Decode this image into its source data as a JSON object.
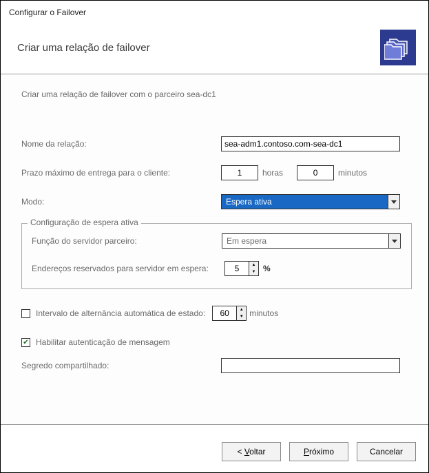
{
  "window": {
    "title": "Configurar o Failover"
  },
  "header": {
    "title": "Criar uma relação de failover"
  },
  "intro": "Criar uma relação de failover com o parceiro sea-dc1",
  "fields": {
    "relation_name_label": "Nome da relação:",
    "relation_name_value": "sea-adm1.contoso.com-sea-dc1",
    "max_client_label": "Prazo máximo de entrega para o cliente:",
    "max_client_hours": "1",
    "hours_unit": "horas",
    "max_client_minutes": "0",
    "minutes_unit": "minutos",
    "mode_label": "Modo:",
    "mode_value": "Espera ativa"
  },
  "group": {
    "legend": "Configuração de espera ativa",
    "partner_role_label": "Função do servidor parceiro:",
    "partner_role_value": "Em espera",
    "reserved_label": "Endereços reservados para servidor em espera:",
    "reserved_value": "5",
    "percent_unit": "%"
  },
  "options": {
    "auto_switch_label": "Intervalo de alternância automática de estado:",
    "auto_switch_checked": false,
    "auto_switch_value": "60",
    "auto_switch_unit": "minutos",
    "msg_auth_label": "Habilitar autenticação de mensagem",
    "msg_auth_checked": true,
    "shared_secret_label": "Segredo compartilhado:",
    "shared_secret_value": ""
  },
  "buttons": {
    "back": "< Voltar",
    "next": "Próximo",
    "cancel": "Cancelar"
  }
}
